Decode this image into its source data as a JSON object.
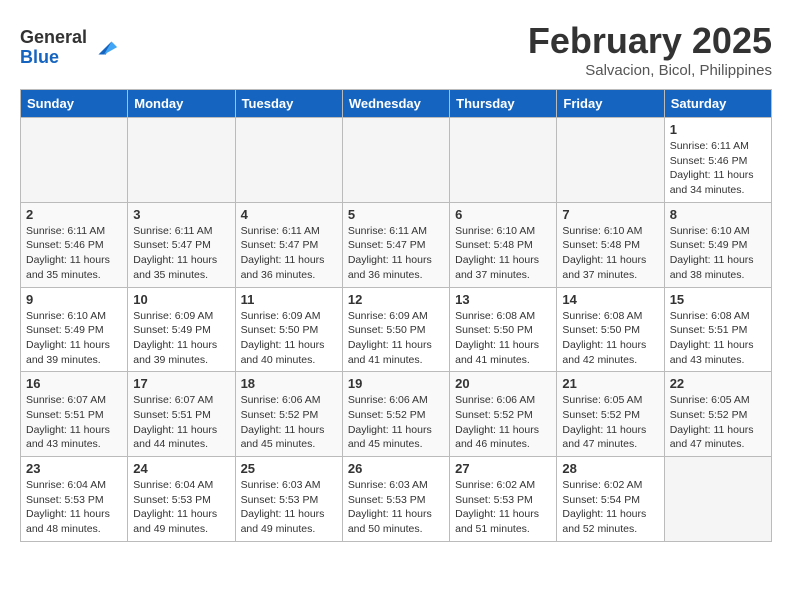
{
  "header": {
    "logo_general": "General",
    "logo_blue": "Blue",
    "month_title": "February 2025",
    "location": "Salvacion, Bicol, Philippines"
  },
  "weekdays": [
    "Sunday",
    "Monday",
    "Tuesday",
    "Wednesday",
    "Thursday",
    "Friday",
    "Saturday"
  ],
  "weeks": [
    [
      {
        "day": "",
        "info": ""
      },
      {
        "day": "",
        "info": ""
      },
      {
        "day": "",
        "info": ""
      },
      {
        "day": "",
        "info": ""
      },
      {
        "day": "",
        "info": ""
      },
      {
        "day": "",
        "info": ""
      },
      {
        "day": "1",
        "info": "Sunrise: 6:11 AM\nSunset: 5:46 PM\nDaylight: 11 hours\nand 34 minutes."
      }
    ],
    [
      {
        "day": "2",
        "info": "Sunrise: 6:11 AM\nSunset: 5:46 PM\nDaylight: 11 hours\nand 35 minutes."
      },
      {
        "day": "3",
        "info": "Sunrise: 6:11 AM\nSunset: 5:47 PM\nDaylight: 11 hours\nand 35 minutes."
      },
      {
        "day": "4",
        "info": "Sunrise: 6:11 AM\nSunset: 5:47 PM\nDaylight: 11 hours\nand 36 minutes."
      },
      {
        "day": "5",
        "info": "Sunrise: 6:11 AM\nSunset: 5:47 PM\nDaylight: 11 hours\nand 36 minutes."
      },
      {
        "day": "6",
        "info": "Sunrise: 6:10 AM\nSunset: 5:48 PM\nDaylight: 11 hours\nand 37 minutes."
      },
      {
        "day": "7",
        "info": "Sunrise: 6:10 AM\nSunset: 5:48 PM\nDaylight: 11 hours\nand 37 minutes."
      },
      {
        "day": "8",
        "info": "Sunrise: 6:10 AM\nSunset: 5:49 PM\nDaylight: 11 hours\nand 38 minutes."
      }
    ],
    [
      {
        "day": "9",
        "info": "Sunrise: 6:10 AM\nSunset: 5:49 PM\nDaylight: 11 hours\nand 39 minutes."
      },
      {
        "day": "10",
        "info": "Sunrise: 6:09 AM\nSunset: 5:49 PM\nDaylight: 11 hours\nand 39 minutes."
      },
      {
        "day": "11",
        "info": "Sunrise: 6:09 AM\nSunset: 5:50 PM\nDaylight: 11 hours\nand 40 minutes."
      },
      {
        "day": "12",
        "info": "Sunrise: 6:09 AM\nSunset: 5:50 PM\nDaylight: 11 hours\nand 41 minutes."
      },
      {
        "day": "13",
        "info": "Sunrise: 6:08 AM\nSunset: 5:50 PM\nDaylight: 11 hours\nand 41 minutes."
      },
      {
        "day": "14",
        "info": "Sunrise: 6:08 AM\nSunset: 5:50 PM\nDaylight: 11 hours\nand 42 minutes."
      },
      {
        "day": "15",
        "info": "Sunrise: 6:08 AM\nSunset: 5:51 PM\nDaylight: 11 hours\nand 43 minutes."
      }
    ],
    [
      {
        "day": "16",
        "info": "Sunrise: 6:07 AM\nSunset: 5:51 PM\nDaylight: 11 hours\nand 43 minutes."
      },
      {
        "day": "17",
        "info": "Sunrise: 6:07 AM\nSunset: 5:51 PM\nDaylight: 11 hours\nand 44 minutes."
      },
      {
        "day": "18",
        "info": "Sunrise: 6:06 AM\nSunset: 5:52 PM\nDaylight: 11 hours\nand 45 minutes."
      },
      {
        "day": "19",
        "info": "Sunrise: 6:06 AM\nSunset: 5:52 PM\nDaylight: 11 hours\nand 45 minutes."
      },
      {
        "day": "20",
        "info": "Sunrise: 6:06 AM\nSunset: 5:52 PM\nDaylight: 11 hours\nand 46 minutes."
      },
      {
        "day": "21",
        "info": "Sunrise: 6:05 AM\nSunset: 5:52 PM\nDaylight: 11 hours\nand 47 minutes."
      },
      {
        "day": "22",
        "info": "Sunrise: 6:05 AM\nSunset: 5:52 PM\nDaylight: 11 hours\nand 47 minutes."
      }
    ],
    [
      {
        "day": "23",
        "info": "Sunrise: 6:04 AM\nSunset: 5:53 PM\nDaylight: 11 hours\nand 48 minutes."
      },
      {
        "day": "24",
        "info": "Sunrise: 6:04 AM\nSunset: 5:53 PM\nDaylight: 11 hours\nand 49 minutes."
      },
      {
        "day": "25",
        "info": "Sunrise: 6:03 AM\nSunset: 5:53 PM\nDaylight: 11 hours\nand 49 minutes."
      },
      {
        "day": "26",
        "info": "Sunrise: 6:03 AM\nSunset: 5:53 PM\nDaylight: 11 hours\nand 50 minutes."
      },
      {
        "day": "27",
        "info": "Sunrise: 6:02 AM\nSunset: 5:53 PM\nDaylight: 11 hours\nand 51 minutes."
      },
      {
        "day": "28",
        "info": "Sunrise: 6:02 AM\nSunset: 5:54 PM\nDaylight: 11 hours\nand 52 minutes."
      },
      {
        "day": "",
        "info": ""
      }
    ]
  ]
}
